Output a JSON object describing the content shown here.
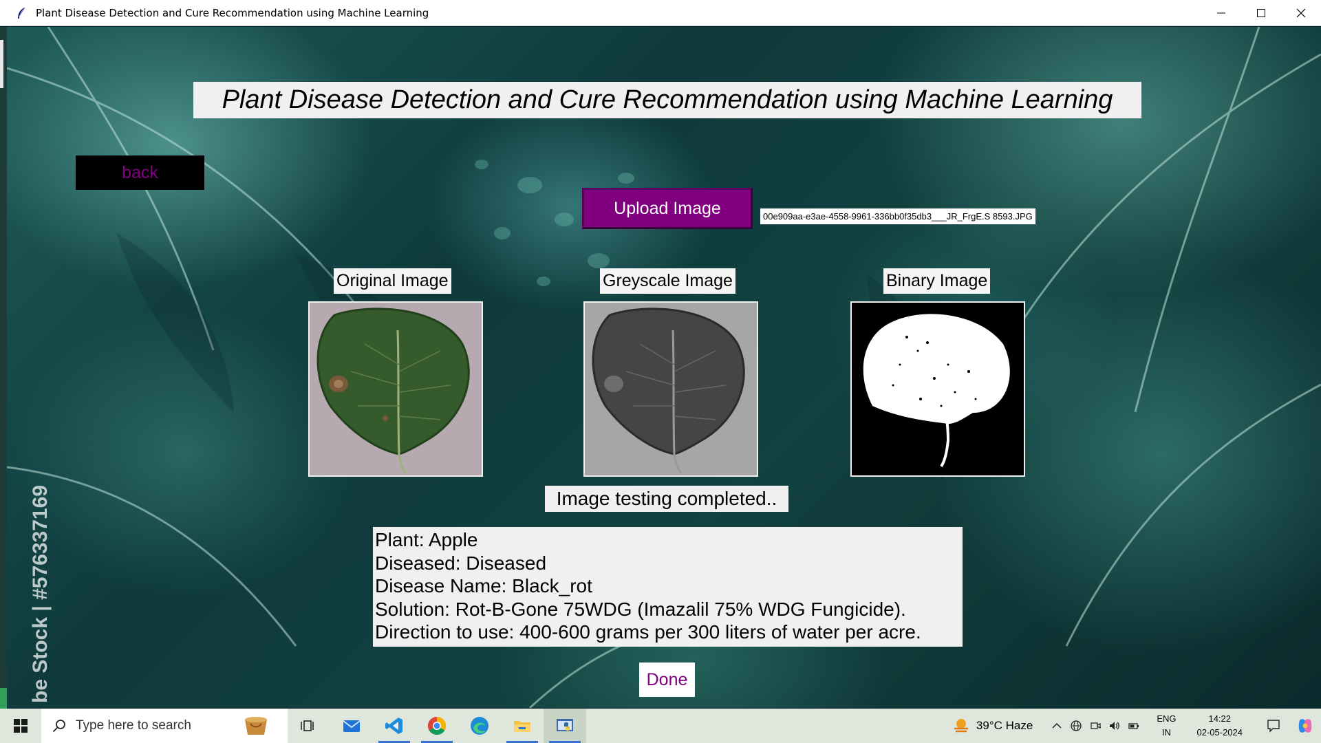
{
  "window": {
    "title": "Plant Disease Detection and Cure Recommendation using Machine Learning"
  },
  "app": {
    "heading": "Plant Disease Detection and Cure Recommendation using Machine Learning",
    "back_label": "back",
    "upload_label": "Upload Image",
    "file_name": "00e909aa-e3ae-4558-9961-336bb0f35db3___JR_FrgE.S 8593.JPG",
    "images": {
      "original_label": "Original Image",
      "greyscale_label": "Greyscale Image",
      "binary_label": "Binary Image"
    },
    "status": "Image testing completed..",
    "result": {
      "plant": "Plant: Apple",
      "diseased": "Diseased: Diseased",
      "disease_name": "Disease Name: Black_rot",
      "solution": "Solution: Rot-B-Gone 75WDG (Imazalil 75% WDG Fungicide).",
      "direction": "Direction to use: 400-600 grams per 300 liters of water per acre."
    },
    "done_label": "Done",
    "watermark": "be Stock | #576337169",
    "colors": {
      "accent": "#800080",
      "button_bg_dark": "#000000",
      "panel_bg": "#f0f0f0"
    }
  },
  "taskbar": {
    "search_placeholder": "Type here to search",
    "apps": [
      "task-view",
      "mail",
      "vs-code",
      "chrome",
      "edge",
      "file-explorer",
      "python"
    ],
    "weather": "39°C  Haze",
    "lang_line1": "ENG",
    "lang_line2": "IN",
    "time": "14:22",
    "date": "02-05-2024"
  }
}
